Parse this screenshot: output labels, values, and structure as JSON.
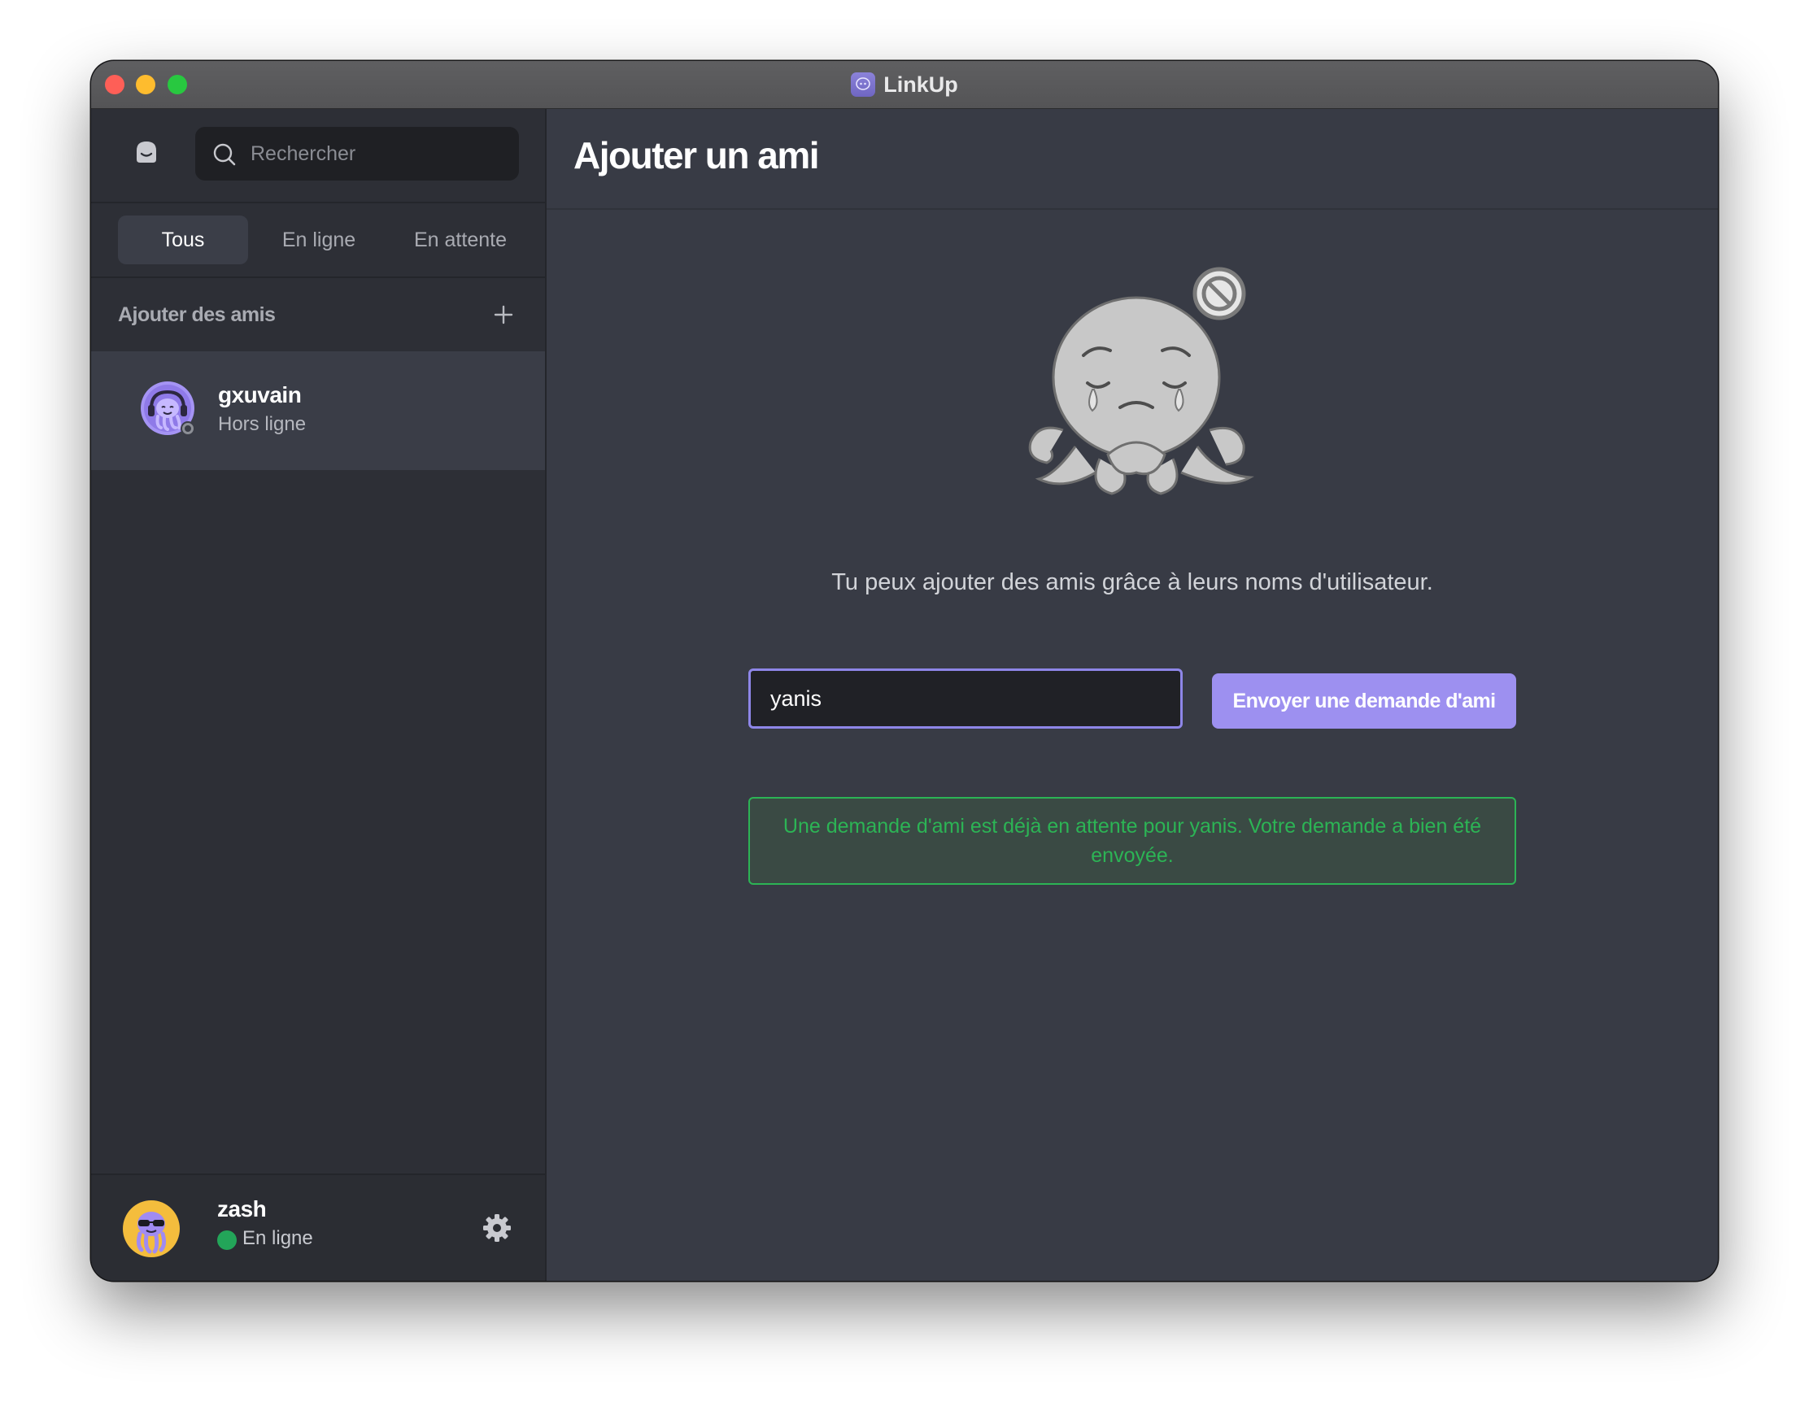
{
  "window": {
    "title": "LinkUp"
  },
  "search": {
    "placeholder": "Rechercher"
  },
  "tabs": [
    {
      "label": "Tous",
      "active": true
    },
    {
      "label": "En ligne",
      "active": false
    },
    {
      "label": "En attente",
      "active": false
    }
  ],
  "sidebar": {
    "add_friends_label": "Ajouter des amis",
    "friends": [
      {
        "name": "gxuvain",
        "status": "Hors ligne"
      }
    ]
  },
  "current_user": {
    "name": "zash",
    "status": "En ligne"
  },
  "main": {
    "title": "Ajouter un ami",
    "hint": "Tu peux ajouter des amis grâce à leurs noms d'utilisateur.",
    "username_value": "yanis",
    "send_button_label": "Envoyer une demande d'ami",
    "notice": "Une demande d'ami est déjà en attente pour yanis. Votre demande a bien été envoyée."
  },
  "colors": {
    "accent": "#9d90f0",
    "success": "#2cb455",
    "online": "#23a559",
    "sidebar_bg": "#2d2f36",
    "main_bg": "#383b45"
  }
}
